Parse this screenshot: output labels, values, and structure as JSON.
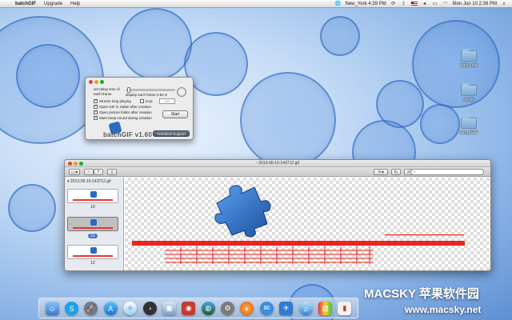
{
  "menubar": {
    "app_name": "batchGIF",
    "menus": [
      "Upgrade",
      "Help"
    ],
    "clock_city": "New_York 4:39 PM",
    "datetime": "Mon Jun 10  2:39 PM"
  },
  "desktop_folders": [
    "daily use",
    "works",
    "temp/GIF"
  ],
  "batchgif": {
    "set_delay_label": "set delay time of each frame",
    "display_each_frame": "display each frame 0.60 S",
    "checkboxes": [
      {
        "label": "Stream loop playing",
        "checked": true
      },
      {
        "label": "loop",
        "checked": false
      },
      {
        "label": "Open GIF in Safari after creation",
        "checked": true
      },
      {
        "label": "Open picture folder after creation",
        "checked": true
      },
      {
        "label": "Mute beep sound during creation",
        "checked": true
      }
    ],
    "loop_value": "999",
    "start_button": "Start",
    "version": "batchGIF v1.60",
    "support_button": "Technical Support"
  },
  "preview": {
    "title": "2013-06-10-143712.gif",
    "sidebar_header": "2013-06-10-143712.gif",
    "frames": [
      "10",
      "11",
      "12"
    ],
    "selected_frame": "11"
  },
  "dock": {
    "apps": [
      "finder",
      "skype",
      "launchpad",
      "app-store",
      "safari",
      "dashboard",
      "preview",
      "photo-booth",
      "google-earth",
      "system-preferences",
      "firefox",
      "messages",
      "mail",
      "itunes",
      "colorsync",
      "chart"
    ]
  },
  "watermark": {
    "brand": "MACSKY 苹果软件园",
    "url": "www.macsky.net"
  },
  "colors": {
    "accent_blue": "#2c6bc4",
    "gif_red": "#e8261e"
  }
}
